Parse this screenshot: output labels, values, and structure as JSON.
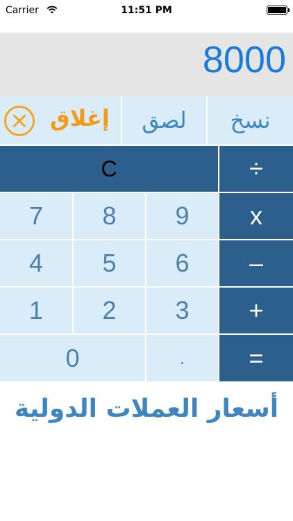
{
  "status": {
    "carrier": "Carrier",
    "time": "11:51 PM",
    "wifi_icon": "wifi-icon",
    "battery_icon": "battery-icon"
  },
  "display": {
    "value": "8000",
    "color": "#1a7ad8"
  },
  "actions": {
    "copy_label": "نسخ",
    "paste_label": "لصق",
    "close_label": "إغلاق",
    "close_icon": "close-icon",
    "accent": "#f39a1b"
  },
  "keypad": {
    "clear": "C",
    "divide": "÷",
    "multiply": "x",
    "minus": "–",
    "plus": "+",
    "equals": "=",
    "seven": "7",
    "eight": "8",
    "nine": "9",
    "four": "4",
    "five": "5",
    "six": "6",
    "one": "1",
    "two": "2",
    "three": "3",
    "zero": "0",
    "dot": "."
  },
  "footer": {
    "title": "أسعار العملات الدولية"
  }
}
